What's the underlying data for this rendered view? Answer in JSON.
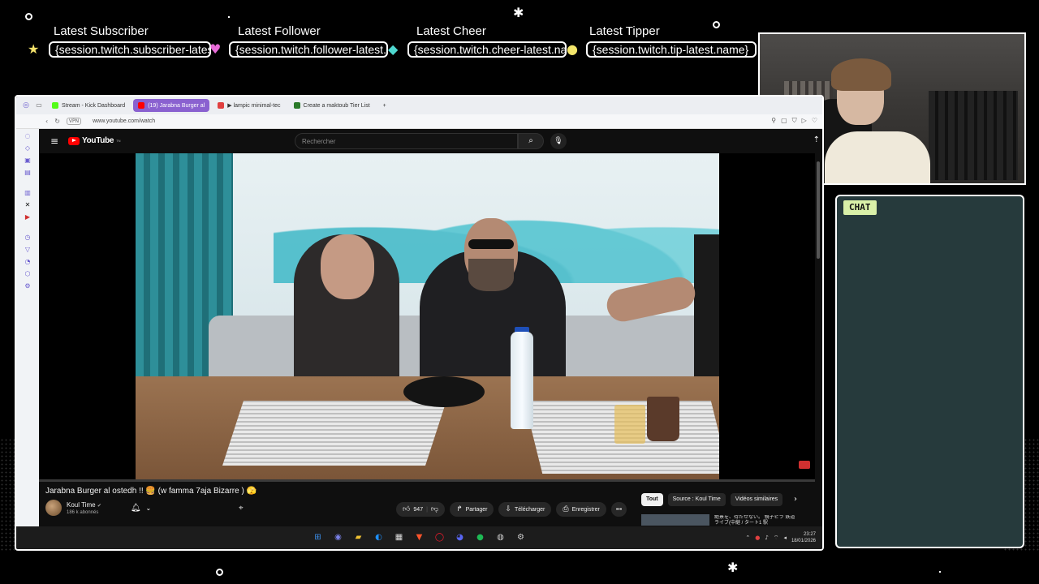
{
  "alerts": [
    {
      "title": "Latest Subscriber",
      "value": "{session.twitch.subscriber-latest.name}",
      "icon": "star-icon",
      "icon_color": "#f5e36b"
    },
    {
      "title": "Latest Follower",
      "value": "{session.twitch.follower-latest.name}",
      "icon": "heart-icon",
      "icon_color": "#e86bd8"
    },
    {
      "title": "Latest Cheer",
      "value": "{session.twitch.cheer-latest.name}",
      "icon": "gem-icon",
      "icon_color": "#4fd8d0"
    },
    {
      "title": "Latest Tipper",
      "value": "{session.twitch.tip-latest.name}",
      "icon": "coin-icon",
      "icon_color": "#f3e56a"
    }
  ],
  "browser": {
    "tabs": [
      {
        "label": "Stream - Kick Dashboard",
        "color": "#53fc18"
      },
      {
        "label": "(19) Jarabna Burger al",
        "color": "#ff0000"
      },
      {
        "label": "▶ lampic minimal-tec",
        "color": "#e04040"
      },
      {
        "label": "Create a maktoub Tier List",
        "color": "#2a7a2a"
      }
    ],
    "new_tab": "+",
    "url": "www.youtube.com/watch"
  },
  "youtube": {
    "logo": "YouTube",
    "logo_sup": "TN",
    "search_placeholder": "Rechercher",
    "video_title": "Jarabna Burger al ostedh !! 🍔 (w famma 7aja Bizarre ) 🫣",
    "channel_name": "Koul Time",
    "verified": "✔",
    "subscribers": "186 k abonnés",
    "likes": "947",
    "share": "Partager",
    "download": "Télécharger",
    "save": "Enregistrer",
    "more": "•••",
    "chips": [
      "Tout",
      "Source : Koul Time",
      "Vidéos similaires"
    ],
    "suggested_title": "絶景を、待たせない。 親子ピラ 鉄道ライブ(中継 / タート1 駅"
  },
  "taskbar": {
    "time": "23:27",
    "date": "18/01/2026"
  },
  "chat": {
    "label": "CHAT"
  },
  "colors": {
    "accent": "#8a61d0",
    "chat_bg": "#263a3c",
    "chat_label_bg": "#d9f0a8",
    "youtube_red": "#ff0000"
  }
}
